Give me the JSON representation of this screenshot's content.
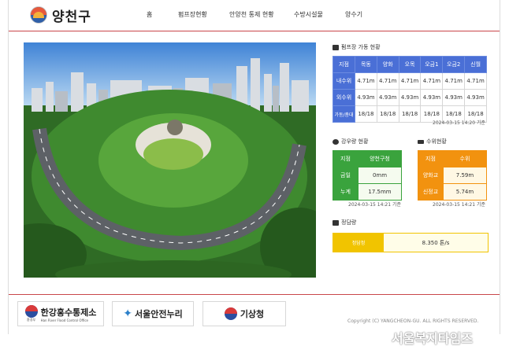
{
  "header": {
    "logo_text": "양천구",
    "nav": [
      "홈",
      "펌프장현황",
      "안양천 통제 현황",
      "수방시설물",
      "양수기"
    ]
  },
  "pump_status": {
    "title": "펌프장 가동 현황",
    "columns": [
      "지점",
      "목동",
      "양화",
      "오목",
      "오금1",
      "오금2",
      "신월"
    ],
    "rows": [
      {
        "label": "내수위",
        "values": [
          "4.71m",
          "4.71m",
          "4.71m",
          "4.71m",
          "4.71m",
          "4.71m"
        ]
      },
      {
        "label": "외수위",
        "values": [
          "4.93m",
          "4.93m",
          "4.93m",
          "4.93m",
          "4.93m",
          "4.93m"
        ]
      },
      {
        "label": "가동/총대",
        "values": [
          "18/18",
          "18/18",
          "18/18",
          "18/18",
          "18/18",
          "18/18"
        ]
      }
    ],
    "timestamp": "2024-03-15  14:20 기준"
  },
  "rainfall": {
    "title": "강우량 현황",
    "col_label": "지점",
    "col_value": "양천구청",
    "rows": [
      {
        "label": "금일",
        "value": "0mm"
      },
      {
        "label": "누계",
        "value": "17.5mm"
      }
    ],
    "timestamp": "2024-03-15  14:21 기준"
  },
  "water_level": {
    "title": "수위현황",
    "col_label": "지점",
    "col_value": "수위",
    "rows": [
      {
        "label": "양화교",
        "value": "7.59m"
      },
      {
        "label": "신정교",
        "value": "5.74m"
      }
    ],
    "timestamp": "2024-03-15  14:21 기준"
  },
  "intake": {
    "title": "정담량",
    "label": "정담정",
    "value": "8.350 톤/s"
  },
  "footer": {
    "partners": [
      {
        "name": "한강홍수통제소",
        "sub": "Han River Flood Control Office",
        "tag": "환경부"
      },
      {
        "name": "서울안전누리"
      },
      {
        "name": "기상청"
      }
    ],
    "copyright": "Copyright (C) YANGCHEON-GU. ALL RIGHTS RESERVED.",
    "watermark": "서울복지타임즈"
  },
  "colors": {
    "accent_red": "#c9464a",
    "pump_blue": "#4a6fd6",
    "rain_green": "#3aa33d",
    "water_orange": "#f2920f",
    "intake_yellow": "#f1c400"
  }
}
